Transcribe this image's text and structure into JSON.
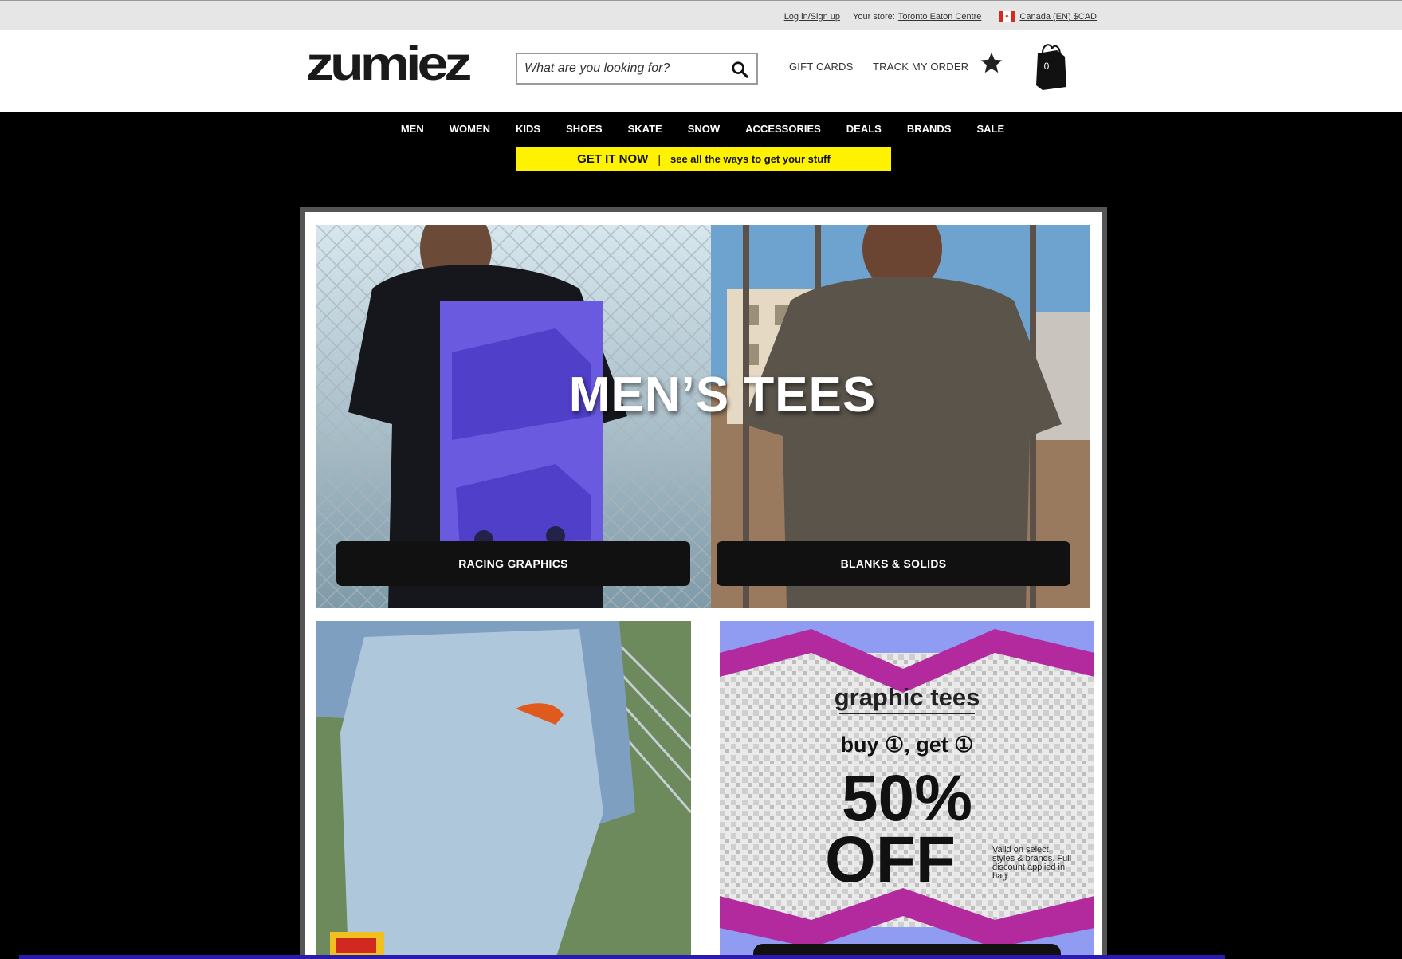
{
  "utility": {
    "login": "Log in/Sign up",
    "store_label": "Your store:",
    "store_name": "Toronto Eaton Centre",
    "region": "Canada (EN) $CAD",
    "flag_icon": "canada-flag-icon"
  },
  "header": {
    "logo": "zumiez",
    "search_placeholder": "What are you looking for?",
    "gift_cards": "GIFT CARDS",
    "track_order": "TRACK MY ORDER",
    "bag_count": "0",
    "icons": [
      "search-icon",
      "star-icon",
      "shopping-bag-icon"
    ]
  },
  "nav": {
    "items": [
      "MEN",
      "WOMEN",
      "KIDS",
      "SHOES",
      "SKATE",
      "SNOW",
      "ACCESSORIES",
      "DEALS",
      "BRANDS",
      "SALE"
    ]
  },
  "promo_bar": {
    "strong": "GET IT NOW",
    "separator": "|",
    "text": "see all the ways to get your stuff",
    "color": "#fff200"
  },
  "hero": {
    "title": "MEN’S TEES",
    "left_cta": "RACING GRAPHICS",
    "right_cta": "BLANKS & SOLIDS"
  },
  "promo_tile": {
    "title": "graphic tees",
    "buy_line": "buy ①, get ①",
    "percent": "50%",
    "off": "OFF",
    "fine_print": "Valid on select styles & brands. Full discount applied in bag.",
    "band_color": "#b22a9e",
    "bg_color": "#8f9cf2"
  }
}
